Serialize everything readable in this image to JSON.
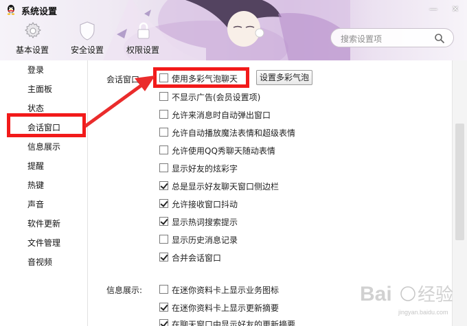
{
  "window": {
    "title": "系统设置",
    "minimize_glyph": "—",
    "close_glyph": "✕"
  },
  "top_tabs": [
    {
      "label": "基本设置",
      "icon": "gear-icon"
    },
    {
      "label": "安全设置",
      "icon": "shield-icon"
    },
    {
      "label": "权限设置",
      "icon": "lock-icon"
    }
  ],
  "search": {
    "placeholder": "搜索设置项",
    "icon": "search-icon"
  },
  "sidebar": {
    "items": [
      {
        "label": "登录"
      },
      {
        "label": "主面板"
      },
      {
        "label": "状态"
      },
      {
        "label": "会话窗口",
        "selected": true
      },
      {
        "label": "信息展示"
      },
      {
        "label": "提醒"
      },
      {
        "label": "热键"
      },
      {
        "label": "声音"
      },
      {
        "label": "软件更新"
      },
      {
        "label": "文件管理"
      },
      {
        "label": "音视频"
      }
    ]
  },
  "session_window": {
    "section_label": "会话窗口:",
    "bubble_button": "设置多彩气泡",
    "options": [
      {
        "label": "使用多彩气泡聊天",
        "checked": false
      },
      {
        "label": "不显示广告(会员设置项)",
        "checked": false
      },
      {
        "label": "允许来消息时自动弹出窗口",
        "checked": false
      },
      {
        "label": "允许自动播放魔法表情和超级表情",
        "checked": false
      },
      {
        "label": "允许使用QQ秀聊天随动表情",
        "checked": false
      },
      {
        "label": "显示好友的炫彩字",
        "checked": false
      },
      {
        "label": "总是显示好友聊天窗口侧边栏",
        "checked": true
      },
      {
        "label": "允许接收窗口抖动",
        "checked": true
      },
      {
        "label": "显示热词搜索提示",
        "checked": true
      },
      {
        "label": "显示历史消息记录",
        "checked": false
      },
      {
        "label": "合并会话窗口",
        "checked": true
      }
    ]
  },
  "info_display": {
    "section_label": "信息展示:",
    "options": [
      {
        "label": "在迷你资料卡上显示业务图标",
        "checked": false
      },
      {
        "label": "在迷你资料卡上显示更新摘要",
        "checked": true
      },
      {
        "label": "在聊天窗口中显示好友的更新摘要",
        "checked": true
      }
    ]
  },
  "colors": {
    "highlight": "#f21a1a",
    "accent": "#ea2c2c"
  },
  "watermark": {
    "text": "Baidu 经验",
    "subtext": "jingyan.baidu.com"
  }
}
